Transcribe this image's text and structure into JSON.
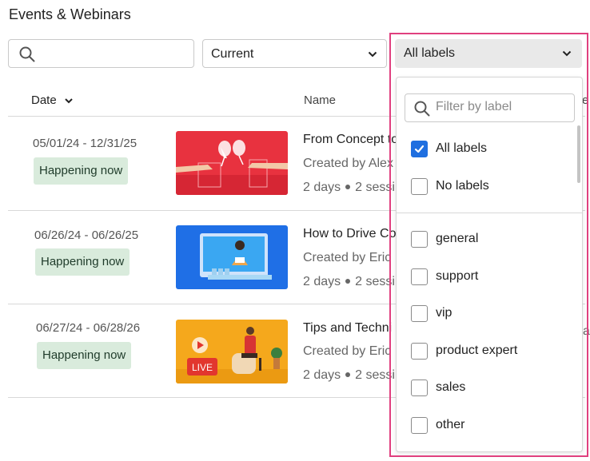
{
  "page": {
    "title": "Events & Webinars"
  },
  "filters": {
    "search_placeholder": "",
    "status_value": "Current",
    "labels_value": "All labels"
  },
  "table": {
    "columns": {
      "date": "Date",
      "name": "Name",
      "extra": "e"
    },
    "rows": [
      {
        "date": "05/01/24 - 12/31/25",
        "badge": "Happening now",
        "title": "From Concept to",
        "creator": "Created by Alex",
        "duration": "2 days",
        "sessions": "2 sessi",
        "extra": ""
      },
      {
        "date": "06/26/24 - 06/26/25",
        "badge": "Happening now",
        "title": "How to Drive Co",
        "creator": "Created by Eric",
        "duration": "2 days",
        "sessions": "2 sessi",
        "extra": ""
      },
      {
        "date": "06/27/24 - 06/28/26",
        "badge": "Happening now",
        "title": "Tips and Techni",
        "creator": "Created by Eric",
        "duration": "2 days",
        "sessions": "2 sessi",
        "extra": "a"
      }
    ]
  },
  "dropdown": {
    "filter_placeholder": "Filter by label",
    "options": [
      {
        "label": "All labels",
        "checked": true
      },
      {
        "label": "No labels",
        "checked": false
      },
      {
        "label": "general",
        "checked": false
      },
      {
        "label": "support",
        "checked": false
      },
      {
        "label": "vip",
        "checked": false
      },
      {
        "label": "product expert",
        "checked": false
      },
      {
        "label": "sales",
        "checked": false
      },
      {
        "label": "other",
        "checked": false
      }
    ]
  },
  "thumbnails": [
    {
      "icon": "toast-glasses-image",
      "bg": "#e8323f"
    },
    {
      "icon": "presenter-screen-image",
      "bg": "#1f6fe6"
    },
    {
      "icon": "live-stream-image",
      "bg": "#f5a81c",
      "badge_text": "LIVE"
    }
  ],
  "colors": {
    "accent": "#1f6fe0",
    "badge_bg": "#d9ebdc",
    "highlight": "#e0407f"
  }
}
